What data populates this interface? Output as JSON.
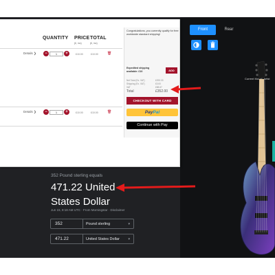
{
  "cart": {
    "columns": {
      "quantity": "QUANTITY",
      "price": "PRICE",
      "total": "TOTAL",
      "currency_note": "(£, inc)"
    },
    "items": [
      {
        "details_label": "Details ❯",
        "qty": "1",
        "price": "£10.00",
        "total": "£10.00"
      },
      {
        "details_label": "Details ❯",
        "qty": "1",
        "price": "£10.00",
        "total": "£10.00"
      }
    ],
    "summary": {
      "congrats": "Congratulations, you currently qualify for free worldwide standard shipping!",
      "expedited": "Expedited shipping available: £10",
      "add_label": "ADD",
      "rows": [
        {
          "label": "Net Total (Ex. VAT)",
          "value": "£293.33"
        },
        {
          "label": "Shipping (Ex. VAT)",
          "value": "£0.00"
        },
        {
          "label": "VAT",
          "value": "£58.67"
        }
      ],
      "total_label": "Total",
      "total_value": "£352.00",
      "checkout_label": "CHECKOUT WITH CARD",
      "paypal_a": "Pay",
      "paypal_b": "Pal",
      "applepay_label": "Continue with  Pay"
    }
  },
  "converter": {
    "caption": "352 Pound sterling equals",
    "result_line1": "471.22 United",
    "result_line2": "States Dollar",
    "date": "Jun 15, 8:18 AM UTC · From Morningstar · Disclaimer",
    "from_amount": "352",
    "from_currency": "Pound sterling",
    "to_amount": "471.22",
    "to_currency": "United States Dollar"
  },
  "configurator": {
    "tab_front": "Front",
    "tab_rear": "Rear",
    "model_label": "Current Model: Artist",
    "icons": [
      "contrast-icon",
      "trash-icon"
    ]
  },
  "colors": {
    "brand_red": "#a3132b",
    "accent_blue": "#1e90ff",
    "annotation_red": "#e41b1b",
    "dark_bg": "#202124"
  }
}
